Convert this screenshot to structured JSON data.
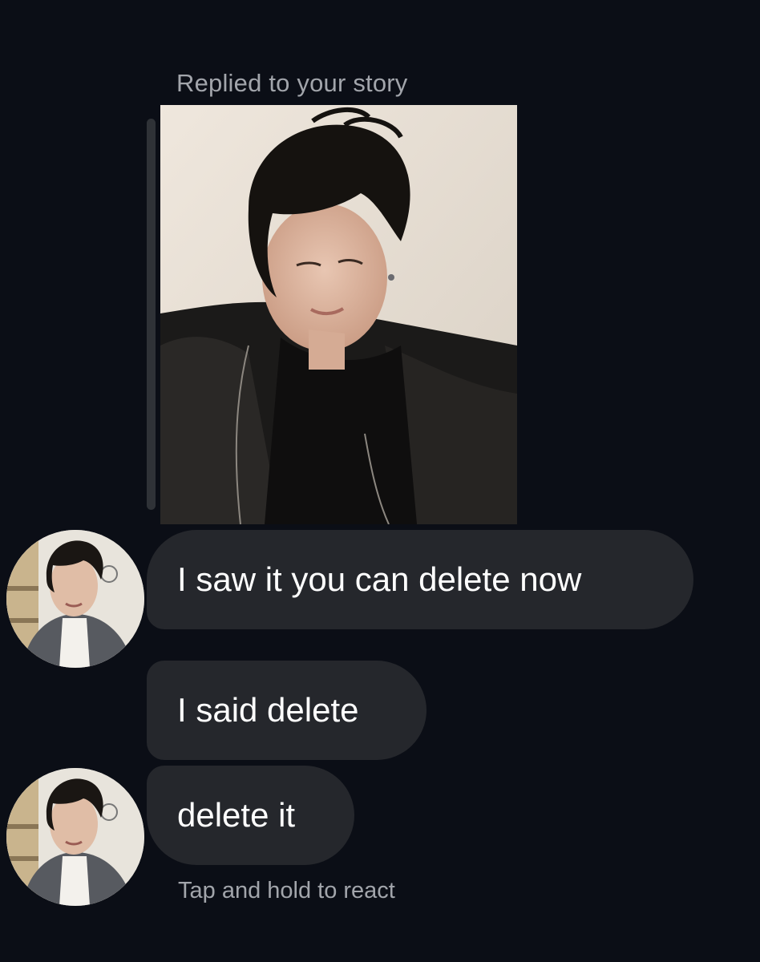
{
  "thread": {
    "reply_context": "Replied to your story",
    "story_image": "story-photo",
    "messages": [
      {
        "text": "I saw it you can delete now",
        "avatar": "contact-avatar"
      },
      {
        "text": "I said delete"
      },
      {
        "text": "delete it",
        "avatar": "contact-avatar"
      }
    ],
    "hint": "Tap and hold to react"
  },
  "colors": {
    "background": "#0b0e16",
    "bubble": "#25272c",
    "secondary_text": "#a2a5ab",
    "reply_bar": "#2f3237"
  }
}
